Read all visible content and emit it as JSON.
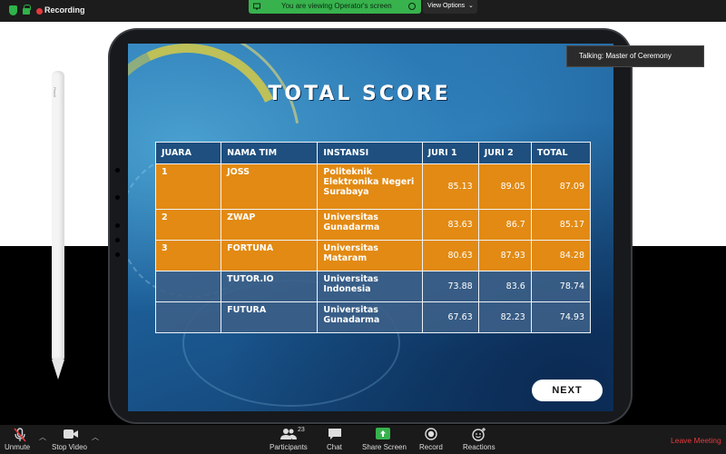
{
  "topbar": {
    "recording_label": "Recording",
    "viewing_text": "You are viewing Operator's screen",
    "view_options_label": "View Options",
    "colors": {
      "green": "#37b24d",
      "red": "#e5393d"
    }
  },
  "pencil_brand": "Pencil",
  "slide": {
    "title": "TOTAL SCORE",
    "headers": [
      "JUARA",
      "NAMA TIM",
      "INSTANSI",
      "JURI 1",
      "JURI 2",
      "TOTAL"
    ],
    "rows": [
      {
        "juara": "1",
        "tim": "JOSS",
        "instansi": "Politeknik Elektronika Negeri Surabaya",
        "juri1": "85.13",
        "juri2": "89.05",
        "total": "87.09"
      },
      {
        "juara": "2",
        "tim": "ZWAP",
        "instansi": "Universitas Gunadarma",
        "juri1": "83.63",
        "juri2": "86.7",
        "total": "85.17"
      },
      {
        "juara": "3",
        "tim": "FORTUNA",
        "instansi": "Universitas Mataram",
        "juri1": "80.63",
        "juri2": "87.93",
        "total": "84.28"
      },
      {
        "juara": "",
        "tim": "TUTOR.IO",
        "instansi": "Universitas Indonesia",
        "juri1": "73.88",
        "juri2": "83.6",
        "total": "78.74"
      },
      {
        "juara": "",
        "tim": "FUTURA",
        "instansi": "Universitas Gunadarma",
        "juri1": "67.63",
        "juri2": "82.23",
        "total": "74.93"
      }
    ],
    "next_label": "NEXT",
    "colors": {
      "gold_row": "#e28a13",
      "blue_row": "#3c5f87"
    }
  },
  "talking": "Talking: Master of Ceremony",
  "toolbar": {
    "unmute": "Unmute",
    "stop_video": "Stop Video",
    "participants": "Participants",
    "participants_count": "23",
    "chat": "Chat",
    "share_screen": "Share Screen",
    "record": "Record",
    "reactions": "Reactions",
    "leave": "Leave Meeting"
  }
}
